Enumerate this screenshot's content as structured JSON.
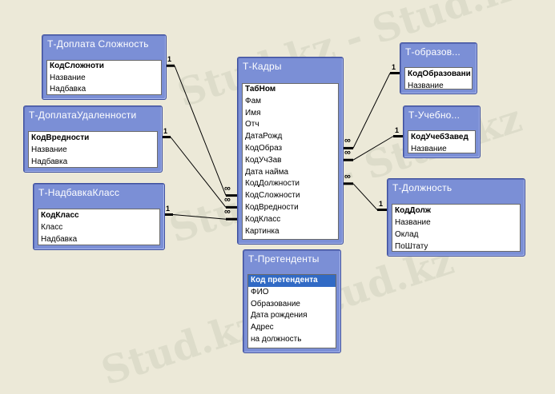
{
  "watermark": {
    "text": "Stud.kz - Stud.kz"
  },
  "tables": [
    {
      "id": "doplata-slozhnost",
      "title": "Т-Доплата Сложность",
      "fields": [
        {
          "label": "КодСложноти",
          "key": true
        },
        {
          "label": "Название"
        },
        {
          "label": "Надбавка"
        }
      ]
    },
    {
      "id": "doplata-udalennosti",
      "title": "Т-ДоплатаУдаленности",
      "fields": [
        {
          "label": "КодВредности",
          "key": true
        },
        {
          "label": "Название"
        },
        {
          "label": "Надбавка"
        }
      ]
    },
    {
      "id": "nadbavka-klass",
      "title": "Т-НадбавкаКласс",
      "fields": [
        {
          "label": "КодКласс",
          "key": true
        },
        {
          "label": "Класс"
        },
        {
          "label": "Надбавка"
        }
      ]
    },
    {
      "id": "kadry",
      "title": "Т-Кадры",
      "fields": [
        {
          "label": "ТабНом",
          "key": true
        },
        {
          "label": "Фам"
        },
        {
          "label": "Имя"
        },
        {
          "label": "Отч"
        },
        {
          "label": "ДатаРожд"
        },
        {
          "label": "КодОбраз"
        },
        {
          "label": "КодУчЗав"
        },
        {
          "label": "Дата найма"
        },
        {
          "label": "КодДолжности"
        },
        {
          "label": "КодСложности"
        },
        {
          "label": "КодВредности"
        },
        {
          "label": "КодКласс"
        },
        {
          "label": "Картинка"
        }
      ]
    },
    {
      "id": "obrazovanie",
      "title": "Т-образов...",
      "fields": [
        {
          "label": "КодОбразовани",
          "key": true
        },
        {
          "label": "Название"
        }
      ]
    },
    {
      "id": "uchebnoe",
      "title": "Т-Учебно...",
      "fields": [
        {
          "label": "КодУчебЗавед",
          "key": true
        },
        {
          "label": "Название"
        }
      ]
    },
    {
      "id": "dolzhnost",
      "title": "Т-Должность",
      "fields": [
        {
          "label": "КодДолж",
          "key": true
        },
        {
          "label": "Название"
        },
        {
          "label": "Оклад"
        },
        {
          "label": "ПоШтату"
        }
      ]
    },
    {
      "id": "pretendenty",
      "title": "Т-Претенденты",
      "fields": [
        {
          "label": "Код претендента",
          "key": true,
          "selected": true
        },
        {
          "label": "ФИО"
        },
        {
          "label": "Образование"
        },
        {
          "label": "Дата рождения"
        },
        {
          "label": "Адрес"
        },
        {
          "label": "на должность"
        }
      ]
    }
  ],
  "relationships": [
    {
      "id": "rel-slozhnost",
      "from_table": "doplata-slozhnost",
      "from_field": 0,
      "to_table": "kadry",
      "to_field": 9,
      "one_label": "1",
      "many_label": "∞"
    },
    {
      "id": "rel-udalennost",
      "from_table": "doplata-udalennosti",
      "from_field": 0,
      "to_table": "kadry",
      "to_field": 10,
      "one_label": "1",
      "many_label": "∞"
    },
    {
      "id": "rel-klass",
      "from_table": "nadbavka-klass",
      "from_field": 0,
      "to_table": "kadry",
      "to_field": 11,
      "one_label": "1",
      "many_label": "∞"
    },
    {
      "id": "rel-obraz",
      "from_table": "obrazovanie",
      "from_field": 0,
      "to_table": "kadry",
      "to_field": 5,
      "one_label": "1",
      "many_label": "∞"
    },
    {
      "id": "rel-uchzav",
      "from_table": "uchebnoe",
      "from_field": 0,
      "to_table": "kadry",
      "to_field": 6,
      "one_label": "1",
      "many_label": "∞"
    },
    {
      "id": "rel-dolzh",
      "from_table": "dolzhnost",
      "from_field": 0,
      "to_table": "kadry",
      "to_field": 8,
      "one_label": "1",
      "many_label": "∞"
    }
  ]
}
